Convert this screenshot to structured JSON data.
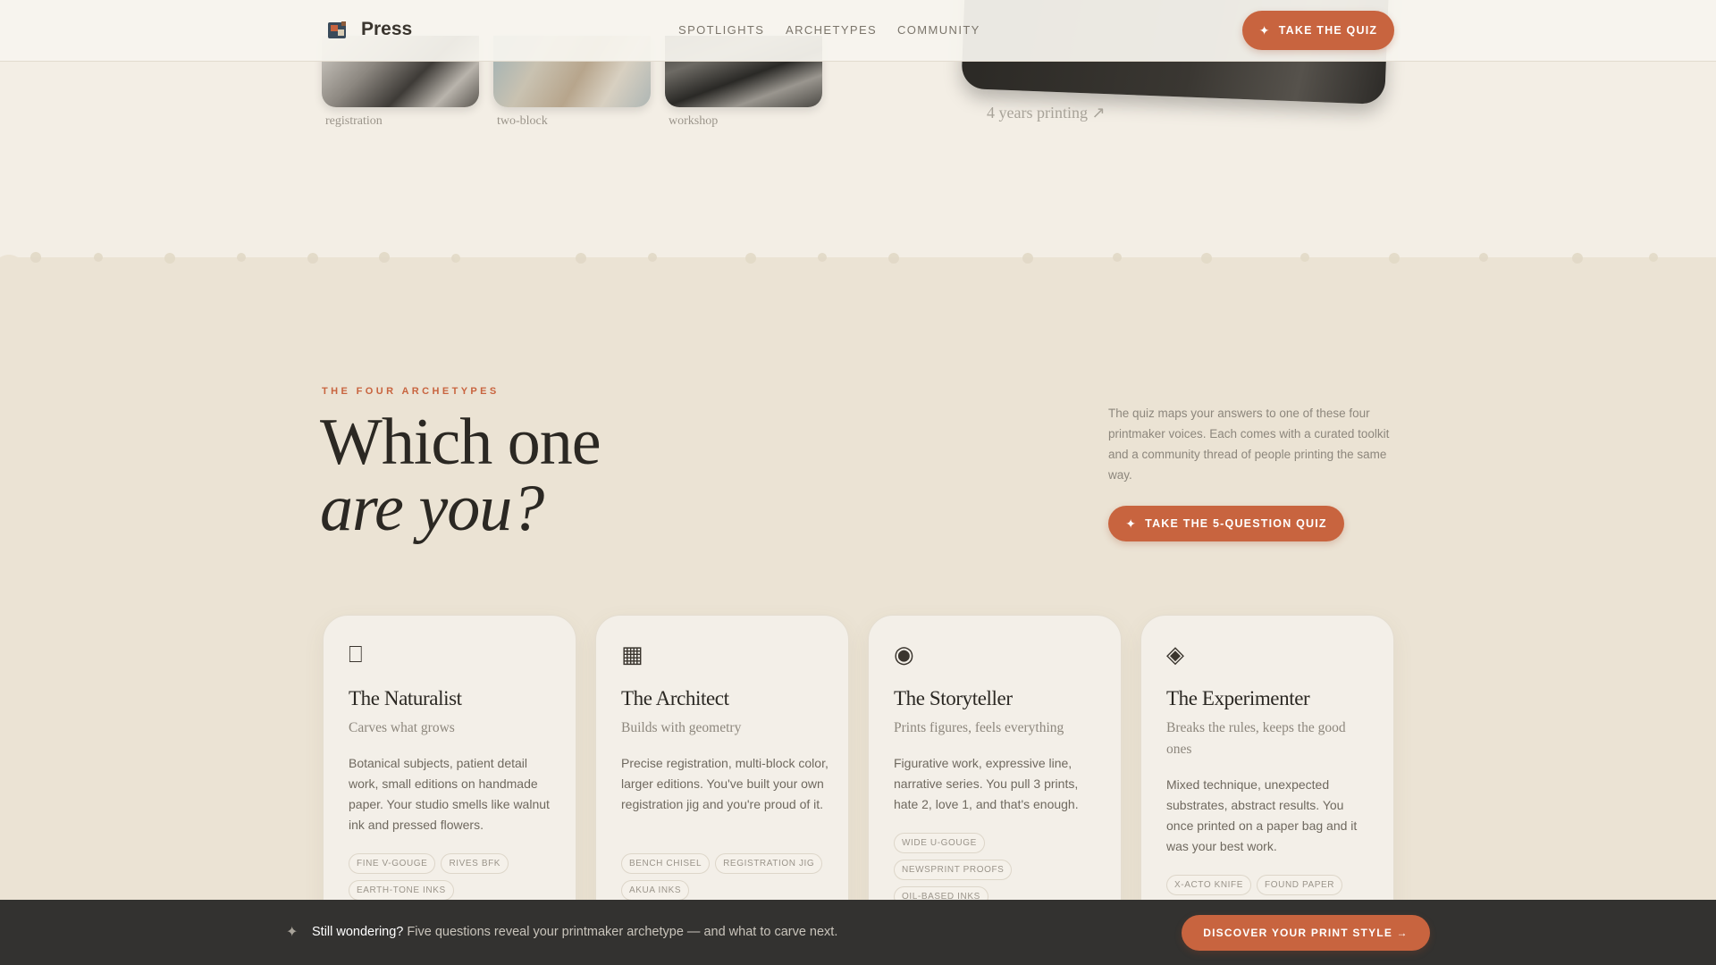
{
  "nav": {
    "logo_text": "Press",
    "links": [
      "SPOTLIGHTS",
      "ARCHETYPES",
      "COMMUNITY"
    ],
    "cta_label": "TAKE THE QUIZ"
  },
  "gallery": {
    "captions": [
      "registration",
      "two-block",
      "workshop"
    ],
    "years_text": "4 years printing ↗"
  },
  "section": {
    "eyebrow": "THE FOUR ARCHETYPES",
    "heading_line1": "Which one",
    "heading_line2": "are you?",
    "intro": "The quiz maps your answers to one of these four printmaker voices. Each comes with a curated toolkit and a community thread of people printing the same way.",
    "cta_label": "TAKE THE 5-QUESTION QUIZ"
  },
  "cards": [
    {
      "icon": "leaf-icon",
      "glyph": "⎕",
      "title": "The Naturalist",
      "subtitle": "Carves what grows",
      "description": "Botanical subjects, patient detail work, small editions on handmade paper. Your studio smells like walnut ink and pressed flowers.",
      "tags": [
        "FINE V-GOUGE",
        "RIVES BFK",
        "EARTH-TONE INKS"
      ]
    },
    {
      "icon": "grid-icon",
      "glyph": "▦",
      "title": "The Architect",
      "subtitle": "Builds with geometry",
      "description": "Precise registration, multi-block color, larger editions. You've built your own registration jig and you're proud of it.",
      "tags": [
        "BENCH CHISEL",
        "REGISTRATION JIG",
        "AKUA INKS"
      ]
    },
    {
      "icon": "circle-dot-icon",
      "glyph": "◉",
      "title": "The Storyteller",
      "subtitle": "Prints figures, feels everything",
      "description": "Figurative work, expressive line, narrative series. You pull 3 prints, hate 2, love 1, and that's enough.",
      "tags": [
        "WIDE U-GOUGE",
        "NEWSPRINT PROOFS",
        "OIL-BASED INKS"
      ]
    },
    {
      "icon": "diamond-icon",
      "glyph": "◈",
      "title": "The Experimenter",
      "subtitle": "Breaks the rules, keeps the good ones",
      "description": "Mixed technique, unexpected substrates, abstract results. You once printed on a paper bag and it was your best work.",
      "tags": [
        "X-ACTO KNIFE",
        "FOUND PAPER"
      ]
    }
  ],
  "bottom_bar": {
    "lead": "Still wondering?",
    "text": " Five questions reveal your printmaker archetype — and what to carve next.",
    "cta_label": "DISCOVER YOUR PRINT STYLE →"
  },
  "colors": {
    "accent": "#c8643f",
    "background": "#ebe3d4",
    "top_band": "#f3eee5",
    "bottom_bar": "#333230"
  }
}
